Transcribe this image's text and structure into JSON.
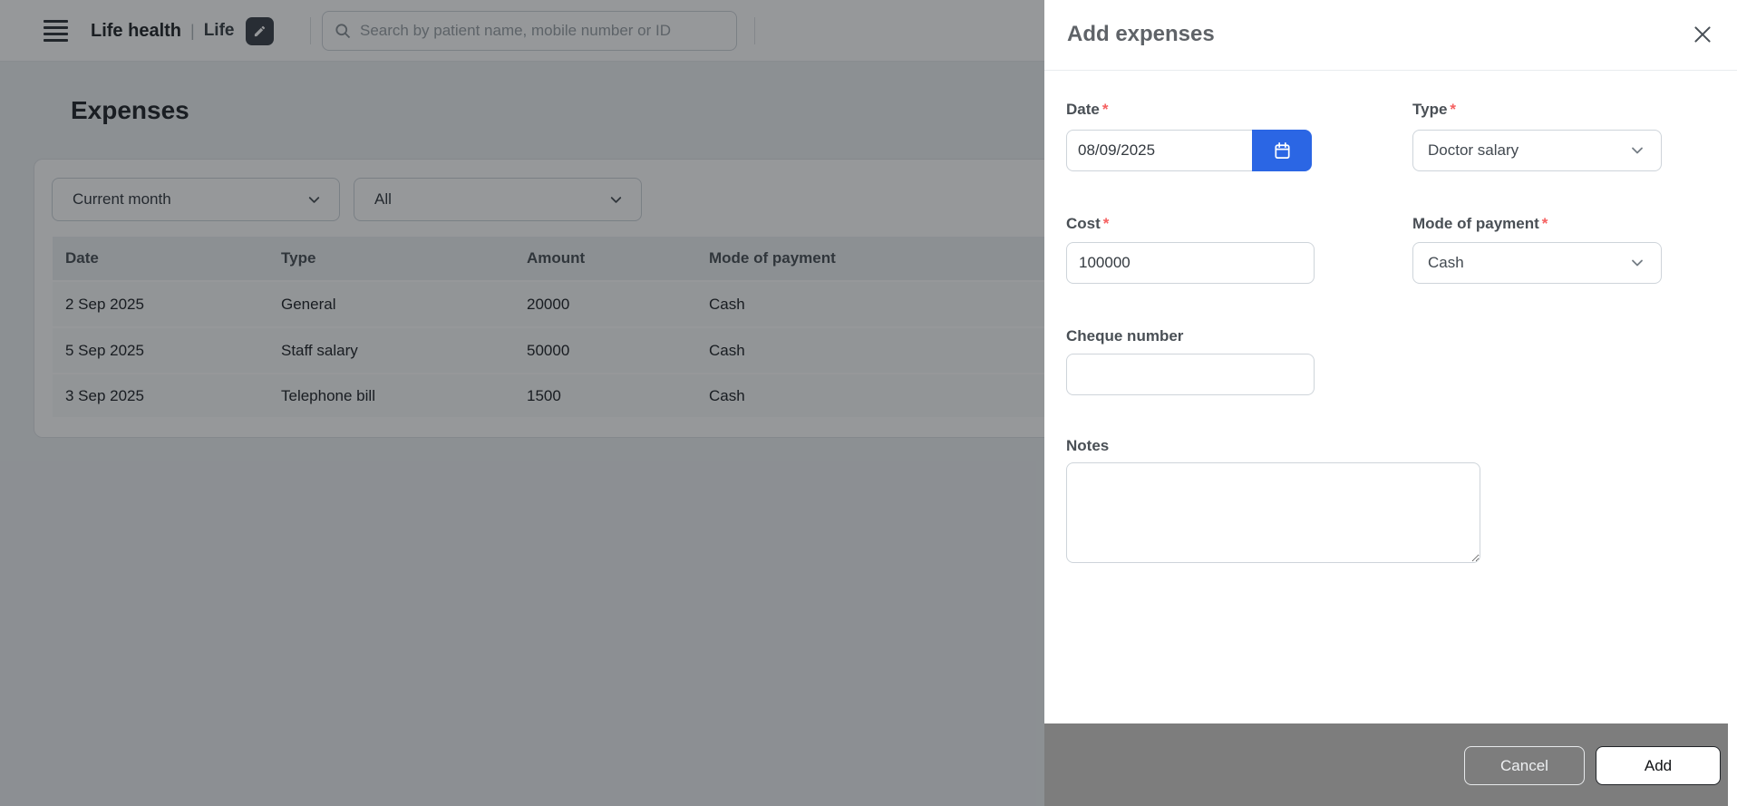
{
  "header": {
    "clinic_name": "Life health",
    "separator": "|",
    "branch_name": "Life",
    "search_placeholder": "Search by patient name, mobile number or ID"
  },
  "page": {
    "title": "Expenses",
    "filters": {
      "period": "Current month",
      "type": "All"
    },
    "table": {
      "columns": [
        "Date",
        "Type",
        "Amount",
        "Mode of payment"
      ],
      "rows": [
        {
          "date": "2 Sep 2025",
          "type": "General",
          "amount": "20000",
          "mode": "Cash"
        },
        {
          "date": "5 Sep 2025",
          "type": "Staff salary",
          "amount": "50000",
          "mode": "Cash"
        },
        {
          "date": "3 Sep 2025",
          "type": "Telephone bill",
          "amount": "1500",
          "mode": "Cash"
        }
      ]
    }
  },
  "drawer": {
    "title": "Add expenses",
    "required_marker": "*",
    "fields": {
      "date": {
        "label": "Date",
        "value": "08/09/2025"
      },
      "type": {
        "label": "Type",
        "value": "Doctor salary"
      },
      "cost": {
        "label": "Cost",
        "value": "100000"
      },
      "mode": {
        "label": "Mode of payment",
        "value": "Cash"
      },
      "cheque": {
        "label": "Cheque number",
        "value": ""
      },
      "notes": {
        "label": "Notes",
        "value": ""
      }
    },
    "footer": {
      "cancel_label": "Cancel",
      "add_label": "Add"
    }
  },
  "colors": {
    "primary_blue": "#2b66e4",
    "required_red": "#f56060",
    "footer_gray": "#7d7d7d"
  },
  "icons": [
    "menu-icon",
    "edit-pencil-icon",
    "search-icon",
    "calendar-icon",
    "chevron-down-icon",
    "close-icon"
  ]
}
